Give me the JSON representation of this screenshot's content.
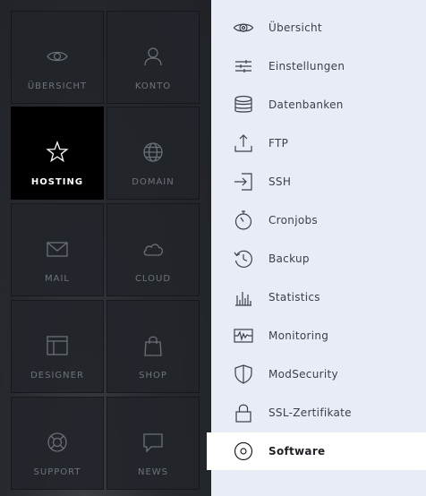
{
  "tiles": [
    {
      "label": "ÜBERSICHT",
      "icon": "eye-icon",
      "active": false
    },
    {
      "label": "KONTO",
      "icon": "user-icon",
      "active": false
    },
    {
      "label": "HOSTING",
      "icon": "star-icon",
      "active": true
    },
    {
      "label": "DOMAIN",
      "icon": "globe-icon",
      "active": false
    },
    {
      "label": "MAIL",
      "icon": "envelope-icon",
      "active": false
    },
    {
      "label": "CLOUD",
      "icon": "cloud-icon",
      "active": false
    },
    {
      "label": "DESIGNER",
      "icon": "layout-icon",
      "active": false
    },
    {
      "label": "SHOP",
      "icon": "shopping-bag-icon",
      "active": false
    },
    {
      "label": "SUPPORT",
      "icon": "lifebuoy-icon",
      "active": false
    },
    {
      "label": "NEWS",
      "icon": "speech-bubble-icon",
      "active": false
    }
  ],
  "menu": [
    {
      "label": "Übersicht",
      "icon": "eye-icon"
    },
    {
      "label": "Einstellungen",
      "icon": "sliders-icon"
    },
    {
      "label": "Datenbanken",
      "icon": "database-icon"
    },
    {
      "label": "FTP",
      "icon": "upload-icon"
    },
    {
      "label": "SSH",
      "icon": "login-arrow-icon"
    },
    {
      "label": "Cronjobs",
      "icon": "stopwatch-icon"
    },
    {
      "label": "Backup",
      "icon": "history-icon"
    },
    {
      "label": "Statistics",
      "icon": "bar-chart-icon"
    },
    {
      "label": "Monitoring",
      "icon": "pulse-icon"
    },
    {
      "label": "ModSecurity",
      "icon": "shield-icon"
    },
    {
      "label": "SSL-Zertifikate",
      "icon": "lock-icon"
    },
    {
      "label": "Software",
      "icon": "disc-icon",
      "selected": true
    }
  ],
  "colors": {
    "sidebar_bg": "#26292e",
    "tile_active": "#000000",
    "menu_bg": "#e8ecf4",
    "menu_selected": "#ffffff"
  }
}
